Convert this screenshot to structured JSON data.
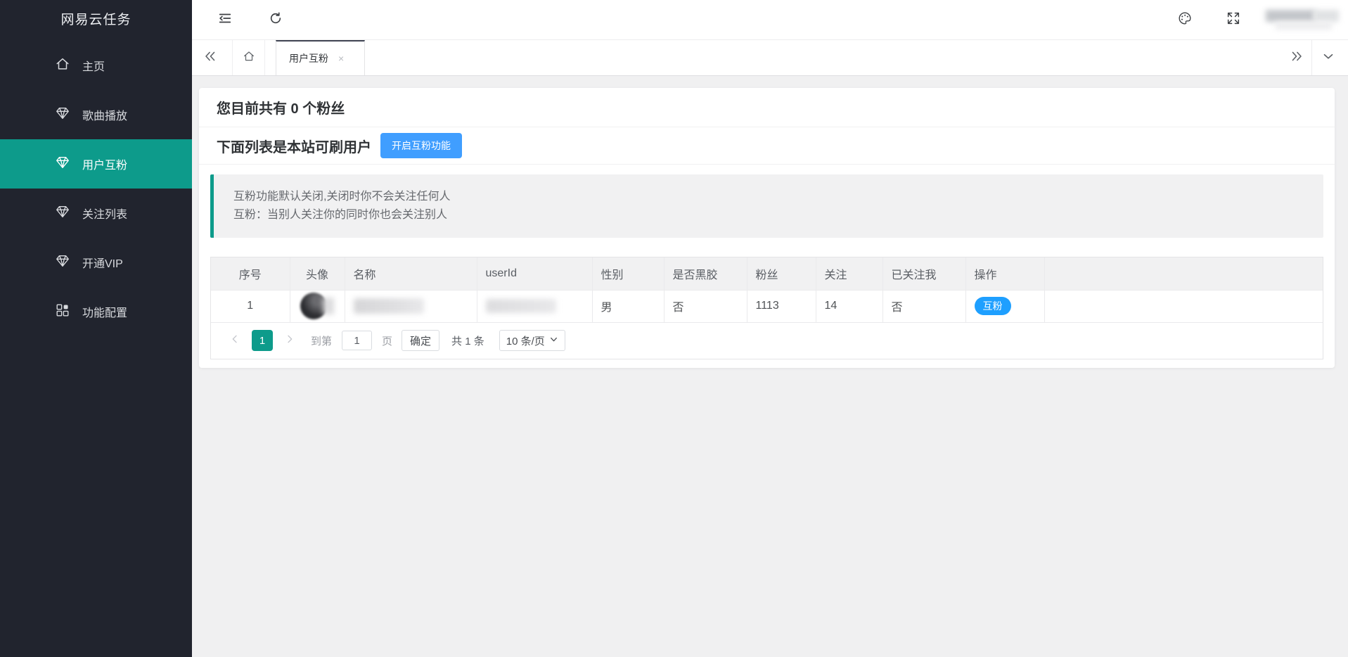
{
  "sidebar": {
    "title": "网易云任务",
    "items": [
      {
        "label": "主页"
      },
      {
        "label": "歌曲播放"
      },
      {
        "label": "用户互粉"
      },
      {
        "label": "关注列表"
      },
      {
        "label": "开通VIP"
      },
      {
        "label": "功能配置"
      }
    ]
  },
  "tabbar": {
    "active_tab": "用户互粉",
    "close": "×"
  },
  "page": {
    "fans_heading": "您目前共有 0 个粉丝",
    "list_heading": "下面列表是本站可刷用户",
    "enable_button": "开启互粉功能",
    "notice": {
      "line1": "互粉功能默认关闭,关闭时你不会关注任何人",
      "line2": "互粉：当别人关注你的同时你也会关注别人"
    },
    "table": {
      "headers": [
        "序号",
        "头像",
        "名称",
        "userId",
        "性别",
        "是否黑胶",
        "粉丝",
        "关注",
        "已关注我",
        "操作",
        ""
      ],
      "row": {
        "index": "1",
        "gender": "男",
        "vinyl": "否",
        "fans": "1113",
        "follows": "14",
        "followed_me": "否",
        "action": "互粉"
      }
    },
    "pagination": {
      "page": "1",
      "goto_label": "到第",
      "goto_value": "1",
      "page_unit": "页",
      "confirm": "确定",
      "total": "共 1 条",
      "per_page": "10 条/页"
    }
  },
  "colors": {
    "accent_teal": "#0d9b8b",
    "primary_blue": "#409eff",
    "pill_blue": "#1e9fff",
    "sidebar_bg": "#21242e"
  }
}
